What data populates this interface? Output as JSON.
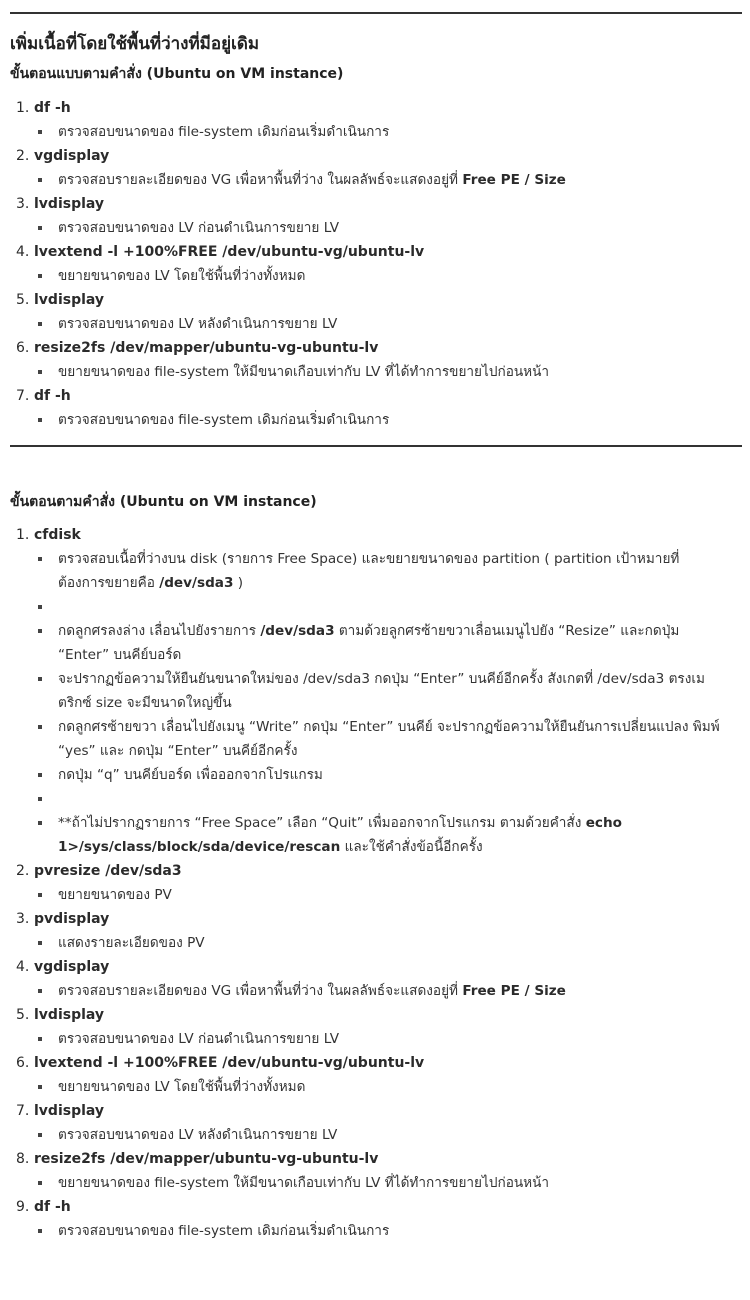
{
  "section1": {
    "title": "เพิ่มเนื้อที่โดยใช้พื้นที่ว่างที่มีอยู่เดิม",
    "subtitle": "ขั้นตอนแบบตามคำสั่ง (Ubuntu on VM instance)",
    "steps": [
      {
        "number": "1.",
        "command": "df -h",
        "notes": [
          {
            "text": "ตรวจสอบขนาดของ file-system เดิมก่อนเริ่มดำเนินการ"
          }
        ]
      },
      {
        "number": "2.",
        "command": "vgdisplay",
        "notes": [
          {
            "text": "ตรวจสอบรายละเอียดของ VG เพื่อหาพื้นที่ว่าง ในผลลัพธ์จะแสดงอยู่ที่ ",
            "bold": "Free PE / Size"
          }
        ]
      },
      {
        "number": "3.",
        "command": "lvdisplay",
        "notes": [
          {
            "text": "ตรวจสอบขนาดของ LV ก่อนดำเนินการขยาย LV"
          }
        ]
      },
      {
        "number": "4.",
        "command": "lvextend -l +100%FREE /dev/ubuntu-vg/ubuntu-lv",
        "notes": [
          {
            "text": "ขยายขนาดของ LV โดยใช้พื้นที่ว่างทั้งหมด"
          }
        ]
      },
      {
        "number": "5.",
        "command": "lvdisplay",
        "notes": [
          {
            "text": "ตรวจสอบขนาดของ LV หลังดำเนินการขยาย LV"
          }
        ]
      },
      {
        "number": "6.",
        "command": "resize2fs /dev/mapper/ubuntu-vg-ubuntu-lv",
        "notes": [
          {
            "text": "ขยายขนาดของ file-system ให้มีขนาดเกือบเท่ากับ LV ที่ได้ทำการขยายไปก่อนหน้า"
          }
        ]
      },
      {
        "number": "7.",
        "command": "df -h",
        "notes": [
          {
            "text": "ตรวจสอบขนาดของ file-system เดิมก่อนเริ่มดำเนินการ"
          }
        ]
      }
    ]
  },
  "section2": {
    "subtitle": "ขั้นตอนตามคำสั่ง (Ubuntu on VM instance)",
    "step1": {
      "number": "1.",
      "command": "cfdisk",
      "notes": {
        "n1_line1": "ตรวจสอบเนื้อที่ว่างบน disk (รายการ Free Space) และขยายขนาดของ partition ( partition เป้าหมายที่",
        "n1_line2": "ต้องการขยายคือ ",
        "n1_bold": "/dev/sda3",
        "n1_tail": " )",
        "n3_a": "กดลูกศรลงล่าง เลื่อนไปยังรายการ ",
        "n3_bold": "/dev/sda3",
        "n3_b": " ตามด้วยลูกศรซ้ายขวาเลื่อนเมนูไปยัง “Resize” และกดปุ่ม",
        "n3_line2": "“Enter” บนคีย์บอร์ด",
        "n4_line1": "จะปรากฏข้อความให้ยืนยันขนาดใหม่ของ /dev/sda3 กดปุ่ม “Enter” บนคีย์อีกครั้ง สังเกตที่ /dev/sda3 ตรงเม",
        "n4_line2": "ตริกซ์ size จะมีขนาดใหญ่ขึ้น",
        "n5_line1": "กดลูกศรซ้ายขวา เลื่อนไปยังเมนู “Write” กดปุ่ม “Enter” บนคีย์ จะปรากฏข้อความให้ยืนยันการเปลี่ยนแปลง พิมพ์",
        "n5_line2": "“yes” และ กดปุ่ม “Enter” บนคีย์อีกครั้ง",
        "n6": "กดปุ่ม “q” บนคีย์บอร์ด เพื่อออกจากโปรแกรม",
        "n8_a": "**ถ้าไม่ปรากฏรายการ “Free Space” เลือก “Quit” เพื่มออกจากโปรแกรม ตามด้วยคำสั่ง ",
        "n8_bold1": "echo",
        "n8_bold2": "1>/sys/class/block/sda/device/rescan",
        "n8_b": " และใช้คำสั่งข้อนี้อีกครั้ง"
      }
    },
    "steps": [
      {
        "number": "2.",
        "command": "pvresize /dev/sda3",
        "notes": [
          {
            "text": "ขยายขนาดของ PV"
          }
        ]
      },
      {
        "number": "3.",
        "command": "pvdisplay",
        "notes": [
          {
            "text": "แสดงรายละเอียดของ PV"
          }
        ]
      },
      {
        "number": "4.",
        "command": "vgdisplay",
        "notes": [
          {
            "text": "ตรวจสอบรายละเอียดของ VG เพื่อหาพื้นที่ว่าง ในผลลัพธ์จะแสดงอยู่ที่ ",
            "bold": "Free PE / Size"
          }
        ]
      },
      {
        "number": "5.",
        "command": "lvdisplay",
        "notes": [
          {
            "text": "ตรวจสอบขนาดของ LV ก่อนดำเนินการขยาย LV"
          }
        ]
      },
      {
        "number": "6.",
        "command": "lvextend -l +100%FREE /dev/ubuntu-vg/ubuntu-lv",
        "notes": [
          {
            "text": "ขยายขนาดของ LV โดยใช้พื้นที่ว่างทั้งหมด"
          }
        ]
      },
      {
        "number": "7.",
        "command": "lvdisplay",
        "notes": [
          {
            "text": "ตรวจสอบขนาดของ LV หลังดำเนินการขยาย LV"
          }
        ]
      },
      {
        "number": "8.",
        "command": "resize2fs /dev/mapper/ubuntu-vg-ubuntu-lv",
        "notes": [
          {
            "text": "ขยายขนาดของ file-system ให้มีขนาดเกือบเท่ากับ LV ที่ได้ทำการขยายไปก่อนหน้า"
          }
        ]
      },
      {
        "number": "9.",
        "command": "df -h",
        "notes": [
          {
            "text": "ตรวจสอบขนาดของ file-system เดิมก่อนเริ่มดำเนินการ"
          }
        ]
      }
    ]
  }
}
